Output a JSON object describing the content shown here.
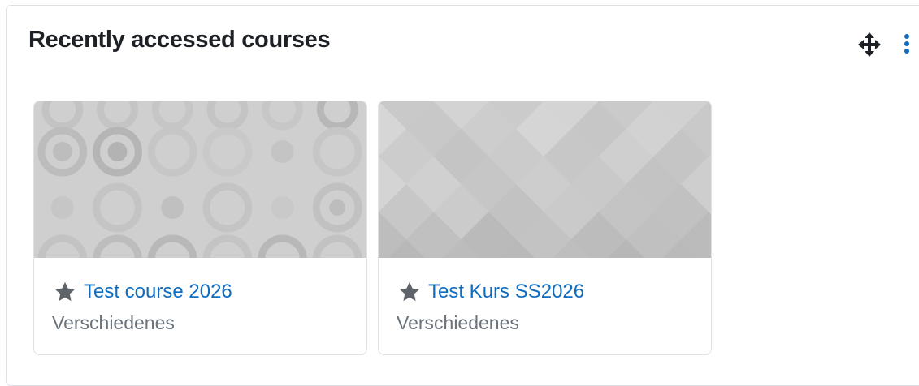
{
  "block": {
    "title": "Recently accessed courses",
    "controls": {
      "move_icon": "move-arrows-icon",
      "menu_icon": "kebab-menu-icon"
    }
  },
  "courses": [
    {
      "name": "Test course 2026",
      "category": "Verschiedenes",
      "pattern": "circles",
      "starred": true
    },
    {
      "name": "Test Kurs SS2026",
      "category": "Verschiedenes",
      "pattern": "diamonds",
      "starred": true
    }
  ],
  "colors": {
    "link": "#0f6cbf",
    "title": "#1d2125",
    "muted": "#6a737b",
    "border": "#dee2e6",
    "image_bg": "#cdcdcd",
    "star": "#5e6469"
  }
}
